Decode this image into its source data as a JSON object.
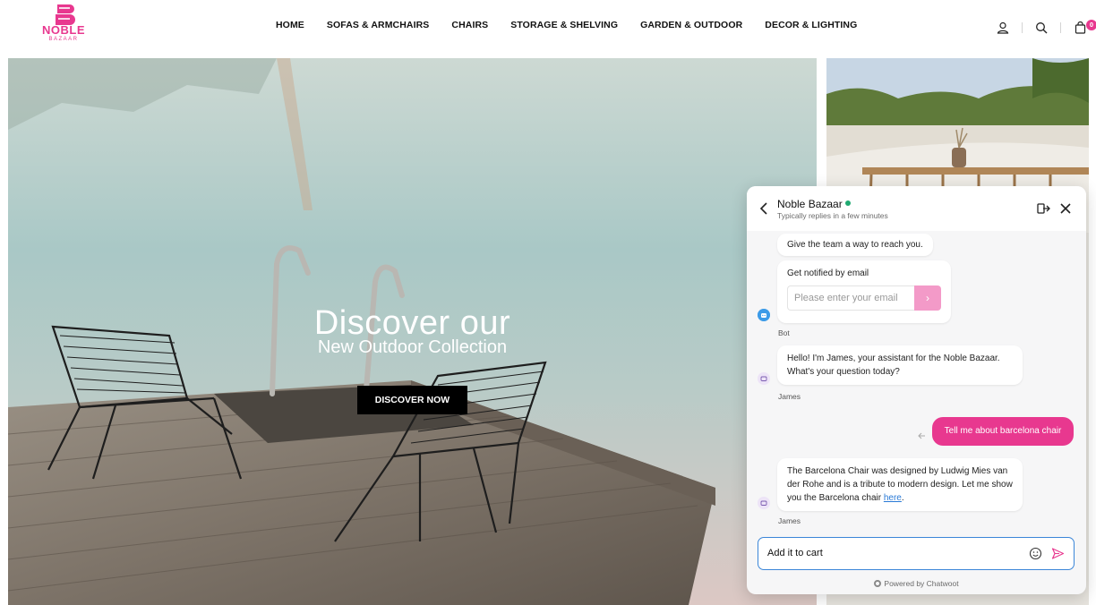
{
  "brand": {
    "name": "NOBLE",
    "sub": "BAZAAR",
    "color": "#e8388f"
  },
  "nav": {
    "items": [
      {
        "label": "HOME"
      },
      {
        "label": "SOFAS & ARMCHAIRS"
      },
      {
        "label": "CHAIRS"
      },
      {
        "label": "STORAGE & SHELVING"
      },
      {
        "label": "GARDEN & OUTDOOR"
      },
      {
        "label": "DECOR & LIGHTING"
      }
    ]
  },
  "header_icons": {
    "account": "user-icon",
    "search": "search-icon",
    "cart": "bag-icon",
    "cart_count": "0"
  },
  "hero": {
    "title": "Discover our",
    "subtitle": "New Outdoor Collection",
    "button_label": "DISCOVER NOW"
  },
  "chat": {
    "title": "Noble Bazaar",
    "status": "Typically replies in a few minutes",
    "reach_message": "Give the team a way to reach you.",
    "email_card": {
      "title": "Get notified by email",
      "placeholder": "Please enter your email",
      "submit_glyph": "›"
    },
    "bot_sender": "Bot",
    "messages": [
      {
        "sender": "James",
        "text": "Hello! I'm James, your assistant for the Noble Bazaar. What's your question today?"
      },
      {
        "sender": "user",
        "text": "Tell me about barcelona chair"
      },
      {
        "sender": "James",
        "text_before": "The Barcelona Chair was designed by Ludwig Mies van der Rohe and is a tribute to modern design. Let me show you the Barcelona chair ",
        "link": "here",
        "text_after": "."
      }
    ],
    "composer_value": "Add it to cart",
    "powered_by": "Powered by Chatwoot",
    "accent": "#e8388f",
    "online_color": "#1fa971"
  }
}
